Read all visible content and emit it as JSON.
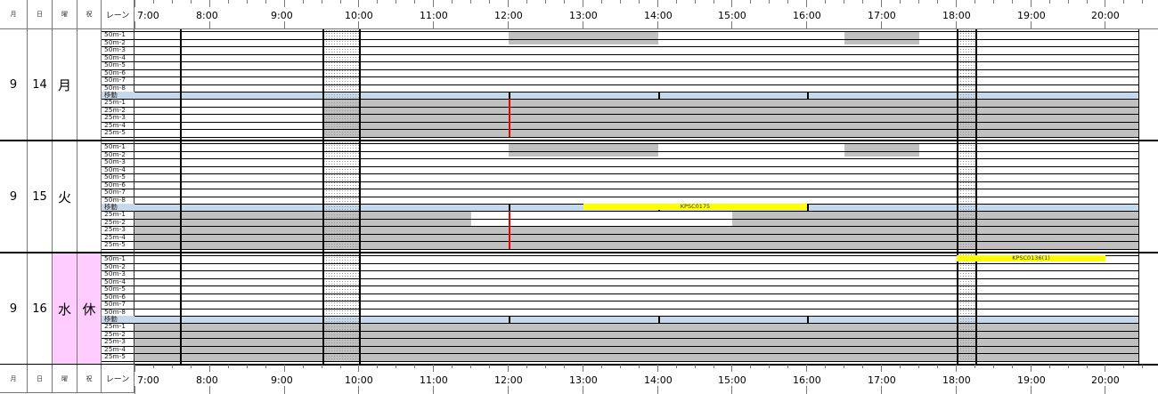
{
  "header": {
    "col_month": "月",
    "col_day": "日",
    "col_dow": "曜",
    "col_holiday": "祝",
    "col_lane": "レーン",
    "hours": [
      "7:00",
      "8:00",
      "9:00",
      "10:00",
      "11:00",
      "12:00",
      "13:00",
      "14:00",
      "15:00",
      "16:00",
      "17:00",
      "18:00",
      "19:00",
      "20:00"
    ]
  },
  "lanes": {
    "long": [
      "50m-1",
      "50m-2",
      "50m-3",
      "50m-4",
      "50m-5",
      "50m-6",
      "50m-7",
      "50m-8"
    ],
    "divider": "移動",
    "short": [
      "25m-1",
      "25m-2",
      "25m-3",
      "25m-4",
      "25m-5"
    ]
  },
  "days": [
    {
      "month": "9",
      "day": "14",
      "dow": "月",
      "holiday": "",
      "highlight": false,
      "bookings": [
        {
          "code": "",
          "start": "12:00",
          "end": "14:00",
          "lanes": "50m-2"
        }
      ]
    },
    {
      "month": "9",
      "day": "15",
      "dow": "火",
      "holiday": "",
      "highlight": false,
      "bookings": [
        {
          "code": "KPSC0175",
          "start": "13:00",
          "end": "16:00",
          "lanes": "移動"
        }
      ]
    },
    {
      "month": "9",
      "day": "16",
      "dow": "水",
      "holiday": "休",
      "highlight": true,
      "bookings": [
        {
          "code": "KPSC0136(1)",
          "start": "18:00",
          "end": "20:00",
          "lanes": "50m-1"
        }
      ]
    }
  ],
  "colors": {
    "blocked": "#c0c0c0",
    "booking": "#ffff00",
    "divider": "#c6d9ec",
    "holiday": "#ffccff",
    "now_marker": "#ee0000"
  }
}
